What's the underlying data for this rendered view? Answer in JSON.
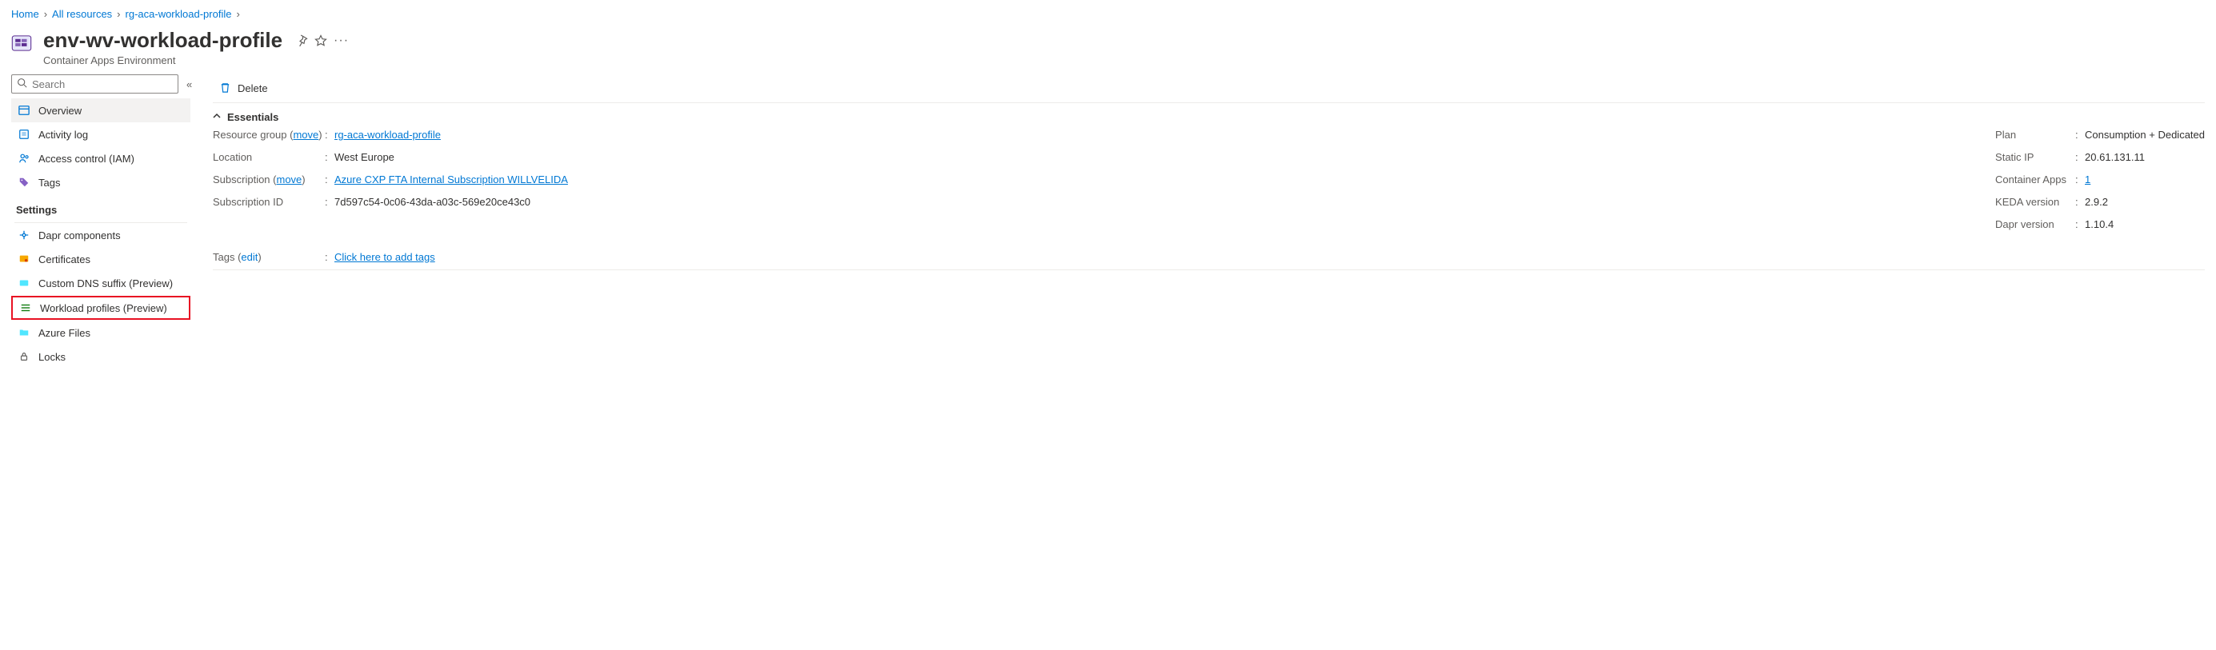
{
  "breadcrumb": [
    {
      "label": "Home"
    },
    {
      "label": "All resources"
    },
    {
      "label": "rg-aca-workload-profile"
    }
  ],
  "header": {
    "title": "env-wv-workload-profile",
    "subtitle": "Container Apps Environment"
  },
  "sidebar": {
    "search_placeholder": "Search",
    "items_top": [
      {
        "label": "Overview",
        "name": "overview",
        "active": true
      },
      {
        "label": "Activity log",
        "name": "activity-log"
      },
      {
        "label": "Access control (IAM)",
        "name": "access-control"
      },
      {
        "label": "Tags",
        "name": "tags"
      }
    ],
    "settings_label": "Settings",
    "items_settings": [
      {
        "label": "Dapr components",
        "name": "dapr-components"
      },
      {
        "label": "Certificates",
        "name": "certificates"
      },
      {
        "label": "Custom DNS suffix (Preview)",
        "name": "custom-dns-suffix"
      },
      {
        "label": "Workload profiles (Preview)",
        "name": "workload-profiles",
        "highlighted": true
      },
      {
        "label": "Azure Files",
        "name": "azure-files"
      },
      {
        "label": "Locks",
        "name": "locks"
      }
    ]
  },
  "command_bar": {
    "delete": "Delete"
  },
  "essentials": {
    "heading": "Essentials",
    "left": {
      "resource_group_key": "Resource group (",
      "resource_group_move": "move",
      "resource_group_key_close": ")",
      "resource_group_val": "rg-aca-workload-profile",
      "location_key": "Location",
      "location_val": "West Europe",
      "subscription_key": "Subscription (",
      "subscription_move": "move",
      "subscription_key_close": ")",
      "subscription_val": "Azure CXP FTA Internal Subscription WILLVELIDA",
      "subscription_id_key": "Subscription ID",
      "subscription_id_val": "7d597c54-0c06-43da-a03c-569e20ce43c0"
    },
    "right": {
      "plan_key": "Plan",
      "plan_val": "Consumption + Dedicated",
      "static_ip_key": "Static IP",
      "static_ip_val": "20.61.131.11",
      "container_apps_key": "Container Apps",
      "container_apps_val": "1",
      "keda_key": "KEDA version",
      "keda_val": "2.9.2",
      "dapr_key": "Dapr version",
      "dapr_val": "1.10.4"
    },
    "tags_key": "Tags (",
    "tags_edit": "edit",
    "tags_key_close": ")",
    "tags_val": "Click here to add tags"
  }
}
